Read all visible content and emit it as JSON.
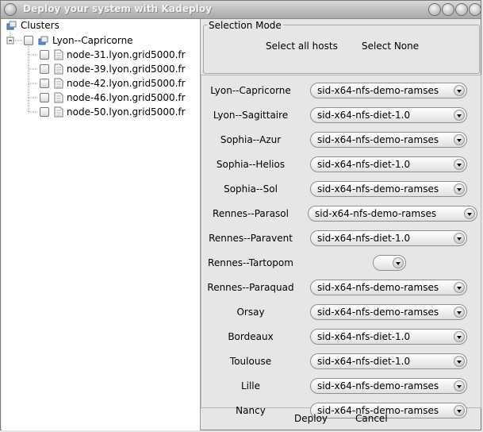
{
  "window": {
    "title": "Deploy your system with Kadeploy"
  },
  "tree": {
    "root_label": "Clusters",
    "cluster_label": "Lyon--Capricorne",
    "nodes": [
      "node-31.lyon.grid5000.fr",
      "node-39.lyon.grid5000.fr",
      "node-42.lyon.grid5000.fr",
      "node-46.lyon.grid5000.fr",
      "node-50.lyon.grid5000.fr"
    ]
  },
  "selection_mode": {
    "title": "Selection Mode",
    "select_all_label": "Select all hosts",
    "select_none_label": "Select None"
  },
  "clusters": [
    {
      "name": "Lyon--Capricorne",
      "image": "sid-x64-nfs-demo-ramses"
    },
    {
      "name": "Lyon--Sagittaire",
      "image": "sid-x64-nfs-diet-1.0"
    },
    {
      "name": "Sophia--Azur",
      "image": "sid-x64-nfs-demo-ramses"
    },
    {
      "name": "Sophia--Helios",
      "image": "sid-x64-nfs-diet-1.0"
    },
    {
      "name": "Sophia--Sol",
      "image": "sid-x64-nfs-demo-ramses"
    },
    {
      "name": "Rennes--Parasol",
      "image": "sid-x64-nfs-demo-ramses"
    },
    {
      "name": "Rennes--Paravent",
      "image": "sid-x64-nfs-diet-1.0"
    },
    {
      "name": "Rennes--Tartopom",
      "image": ""
    },
    {
      "name": "Rennes--Paraquad",
      "image": "sid-x64-nfs-demo-ramses"
    },
    {
      "name": "Orsay",
      "image": "sid-x64-nfs-demo-ramses"
    },
    {
      "name": "Bordeaux",
      "image": "sid-x64-nfs-diet-1.0"
    },
    {
      "name": "Toulouse",
      "image": "sid-x64-nfs-diet-1.0"
    },
    {
      "name": "Lille",
      "image": "sid-x64-nfs-demo-ramses"
    },
    {
      "name": "Nancy",
      "image": "sid-x64-nfs-demo-ramses"
    }
  ],
  "actions": {
    "deploy_label": "Deploy",
    "cancel_label": "Cancel"
  }
}
